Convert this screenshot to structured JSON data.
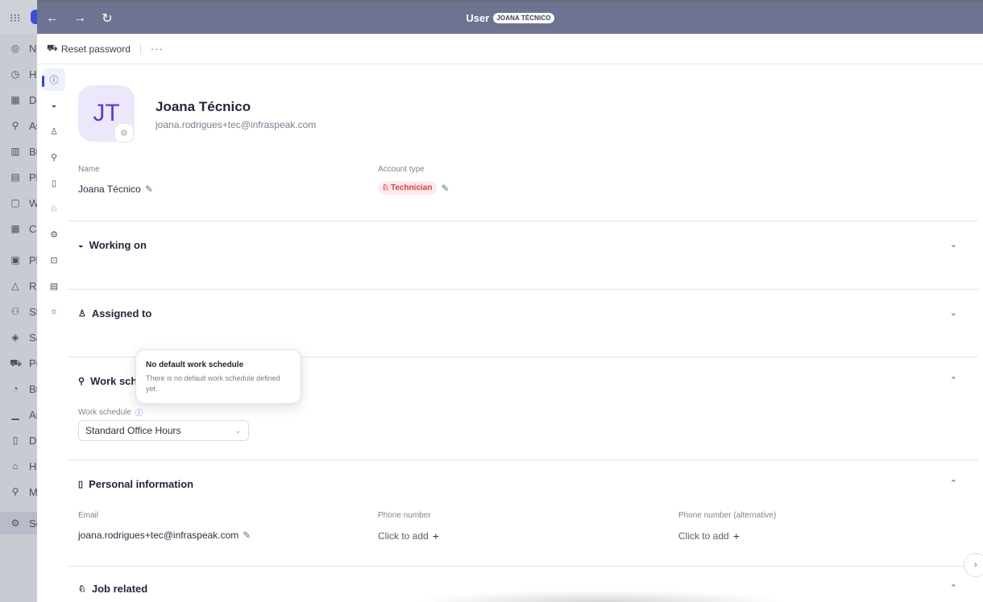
{
  "background_sidebar": {
    "apps_icon": "grid-icon",
    "items": [
      {
        "icon": "globe-icon",
        "glyph": "◎",
        "label": "No"
      },
      {
        "icon": "clock-icon",
        "glyph": "◷",
        "label": "H"
      },
      {
        "icon": "dashboard-icon",
        "glyph": "▦",
        "label": "Da"
      },
      {
        "icon": "asset-icon",
        "glyph": "⚲",
        "label": "As"
      },
      {
        "icon": "building-icon",
        "glyph": "▥",
        "label": "Bu"
      },
      {
        "icon": "calendar-icon",
        "glyph": "▤",
        "label": "Pl"
      },
      {
        "icon": "clipboard-icon",
        "glyph": "▢",
        "label": "W"
      },
      {
        "icon": "table-icon",
        "glyph": "▦",
        "label": "C"
      },
      {
        "icon": "doc-icon",
        "glyph": "▣",
        "label": "Pl"
      },
      {
        "icon": "bell-icon",
        "glyph": "△",
        "label": "Re"
      },
      {
        "icon": "users-icon",
        "glyph": "⚇",
        "label": "St"
      },
      {
        "icon": "tag-icon",
        "glyph": "◈",
        "label": "Sa"
      },
      {
        "icon": "cart-icon",
        "glyph": "⛟",
        "label": "Pu"
      },
      {
        "icon": "budget-icon",
        "glyph": "◔",
        "label": "Bu"
      },
      {
        "icon": "chart-icon",
        "glyph": "▁",
        "label": "An"
      },
      {
        "icon": "file-icon",
        "glyph": "▯",
        "label": "Do"
      },
      {
        "icon": "home-icon",
        "glyph": "⌂",
        "label": "Ho"
      },
      {
        "icon": "pin-icon",
        "glyph": "⚲",
        "label": "M"
      },
      {
        "icon": "settings-icon",
        "glyph": "⚙",
        "label": "Se"
      }
    ]
  },
  "header": {
    "back_icon": "←",
    "forward_icon": "→",
    "refresh_icon": "↻",
    "title": "User",
    "badge": "JOANA TÉCNICO"
  },
  "toolbar": {
    "reset_icon": "⛟",
    "reset_label": "Reset password",
    "more_label": "···"
  },
  "rail": {
    "items": [
      {
        "name": "info-icon",
        "glyph": "ⓘ"
      },
      {
        "name": "half-circle-icon",
        "glyph": "◒"
      },
      {
        "name": "person-icon",
        "glyph": "♙"
      },
      {
        "name": "schedule-icon",
        "glyph": "⚲"
      },
      {
        "name": "book-icon",
        "glyph": "▯"
      },
      {
        "name": "worker-icon",
        "glyph": "♘"
      },
      {
        "name": "gear-icon",
        "glyph": "⚙"
      },
      {
        "name": "lock-icon",
        "glyph": "⊡"
      },
      {
        "name": "document-icon",
        "glyph": "▤"
      },
      {
        "name": "bug-icon",
        "glyph": "☼"
      }
    ]
  },
  "profile": {
    "initials": "JT",
    "camera_icon": "⊙",
    "name": "Joana Técnico",
    "email": "joana.rodrigues+tec@infraspeak.com",
    "name_label": "Name",
    "name_value": "Joana Técnico",
    "account_type_label": "Account type",
    "account_type_value": "Technician",
    "account_type_icon": "♘",
    "pencil_icon": "✎"
  },
  "sections": {
    "working_on": {
      "icon": "◒",
      "title": "Working on",
      "chevron": "⌄"
    },
    "assigned_to": {
      "icon": "♙",
      "title": "Assigned to",
      "chevron": "⌄"
    },
    "work_schedule": {
      "icon": "⚲",
      "title": "Work sch",
      "chevron": "⌃",
      "label": "Work schedule",
      "info_icon": "ⓘ",
      "selected": "Standard Office Hours",
      "dropdown_icon": "⌄"
    },
    "personal_information": {
      "icon": "▯",
      "title": "Personal information",
      "chevron": "⌃",
      "email_label": "Email",
      "email_value": "joana.rodrigues+tec@infraspeak.com",
      "phone_label": "Phone number",
      "phone_value": "Click to add",
      "phone_alt_label": "Phone number (alternative)",
      "phone_alt_value": "Click to add",
      "plus_icon": "+"
    },
    "job_related": {
      "icon": "♘",
      "title": "Job related",
      "chevron": "⌃"
    }
  },
  "tooltip": {
    "title": "No default work schedule",
    "body": "There is no default work schedule defined yet."
  },
  "side_button_icon": "›"
}
